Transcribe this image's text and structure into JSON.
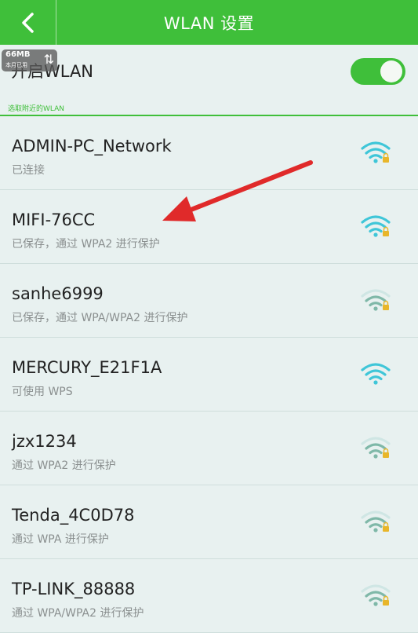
{
  "header": {
    "title": "WLAN 设置",
    "back_icon": "chevron-left-icon"
  },
  "toggle_row": {
    "label": "开启WLAN",
    "enabled": true
  },
  "badge": {
    "size": "66MB",
    "sub": "本月已用",
    "arrows": "⇅"
  },
  "section": {
    "label": "选取附近的WLAN"
  },
  "colors": {
    "accent": "#3fbf3a",
    "wifi": "#3fc6d8",
    "wifi_weak": "#7fb8a8",
    "lock": "#e8b62a",
    "arrow": "#e02a2a"
  },
  "networks": [
    {
      "name": "ADMIN-PC_Network",
      "status": "已连接",
      "locked": true,
      "strength": 4
    },
    {
      "name": "MIFI-76CC",
      "status": "已保存，通过 WPA2 进行保护",
      "locked": true,
      "strength": 4
    },
    {
      "name": "sanhe6999",
      "status": "已保存，通过 WPA/WPA2 进行保护",
      "locked": true,
      "strength": 2
    },
    {
      "name": "MERCURY_E21F1A",
      "status": "可使用 WPS",
      "locked": false,
      "strength": 4
    },
    {
      "name": "jzx1234",
      "status": "通过 WPA2 进行保护",
      "locked": true,
      "strength": 2
    },
    {
      "name": "Tenda_4C0D78",
      "status": "通过 WPA 进行保护",
      "locked": true,
      "strength": 2
    },
    {
      "name": "TP-LINK_88888",
      "status": "通过 WPA/WPA2 进行保护",
      "locked": true,
      "strength": 2
    }
  ]
}
